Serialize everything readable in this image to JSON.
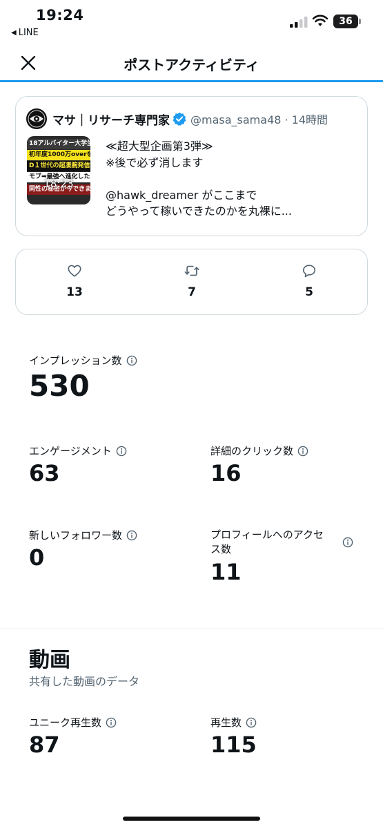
{
  "status": {
    "time": "19:24",
    "back_app": "LINE",
    "battery": "36"
  },
  "nav": {
    "title": "ポストアクティビティ"
  },
  "tweet": {
    "author_name": "マサ｜リサーチ専門家",
    "handle": "@masa_sama48 · 14時間",
    "thumbnail_lines": [
      "18アルバイター大学生が",
      "初年度1000万overを稼",
      "D１世代の超凄腕発信者",
      "モブ➡最強へ進化した",
      "同性の秘密が今できます"
    ],
    "video_duration": "18:23",
    "text_lines": [
      "≪超大型企画第3弾≫",
      "※後で必ず消します",
      "",
      " @hawk_dreamer がここまで",
      "どうやって稼いできたのかを丸裸に..."
    ]
  },
  "engagement": {
    "likes": "13",
    "retweets": "7",
    "replies": "5"
  },
  "metrics": {
    "impressions_label": "インプレッション数",
    "impressions": "530",
    "engagements_label": "エンゲージメント",
    "engagements": "63",
    "detail_clicks_label": "詳細のクリック数",
    "detail_clicks": "16",
    "new_followers_label": "新しいフォロワー数",
    "new_followers": "0",
    "profile_visits_label_line1": "プロフィールへのアクセ",
    "profile_visits_label_line2": "ス数",
    "profile_visits": "11"
  },
  "video": {
    "title": "動画",
    "subtitle": "共有した動画のデータ",
    "unique_plays_label": "ユニーク再生数",
    "unique_plays": "87",
    "plays_label": "再生数",
    "plays": "115"
  },
  "colors": {
    "accent": "#1d9bf0",
    "text": "#0f1419",
    "secondary": "#536471",
    "border": "#cfd9de"
  }
}
